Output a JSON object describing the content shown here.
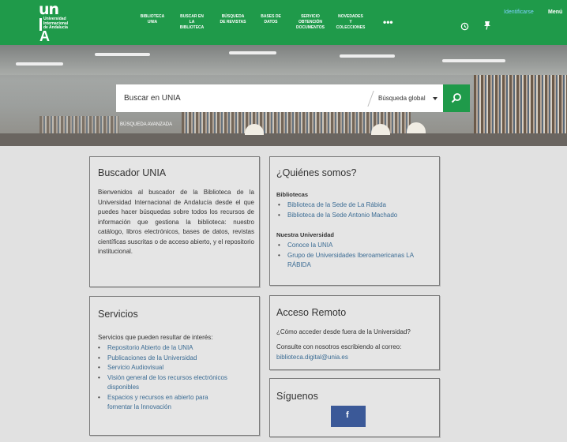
{
  "logo": {
    "un": "un",
    "lines": [
      "Universidad",
      "Internacional",
      "de Andalucía"
    ],
    "a": "A"
  },
  "nav": [
    "BIBLIOTECA\nUNIA",
    "BUSCAR EN\nLA\nBIBLIOTECA",
    "BÚSQUEDA\nDE REVISTAS",
    "BASES DE\nDATOS",
    "SERVICIO\nOBTENCIÓN\nDOCUMENTOS",
    "NOVEDADES\nY\nCOLECCIONES"
  ],
  "nav_more": "•••",
  "header": {
    "identify": "Identificarse",
    "menu": "Menú",
    "history_icon": "history-icon",
    "pin_icon": "pin-icon"
  },
  "search": {
    "placeholder": "Buscar en UNIA",
    "scope": "Búsqueda global",
    "advanced": "BÚSQUEDA AVANZADA",
    "button_icon": "search-icon"
  },
  "buscador": {
    "title": "Buscador UNIA",
    "text": "Bienvenidos al buscador de la Biblioteca de la Universidad Internacional de Andalucía desde el que puedes hacer búsquedas sobre todos los recursos de información que gestiona la biblioteca: nuestro catálogo, libros electrónicos, bases de datos, revistas científicas suscritas o de acceso abierto, y el repositorio institucional."
  },
  "quienes": {
    "title": "¿Quiénes somos?",
    "bibliotecas_label": "Bibliotecas",
    "bibliotecas": [
      "Biblioteca de la Sede de La Rábida",
      "Biblioteca de la Sede Antonio Machado"
    ],
    "universidad_label": "Nuestra Universidad",
    "universidad": [
      "Conoce la UNIA",
      "Grupo de Universidades Iberoamericanas LA RÁBIDA"
    ]
  },
  "servicios": {
    "title": "Servicios",
    "intro": "Servicios que pueden resultar de interés:",
    "items": [
      "Repositorio Abierto de la UNIA",
      "Publicaciones de la Universidad",
      "Servicio Audiovisual",
      "Visión general de los recursos electrónicos disponibles",
      "Espacios y recursos en abierto para fomentar la Innovación"
    ]
  },
  "acceso": {
    "title": "Acceso Remoto",
    "question": "¿Cómo acceder desde fuera de la Universidad?",
    "consult": "Consulte con nosotros escribiendo al correo:",
    "email": "biblioteca.digital@unia.es"
  },
  "siguenos": {
    "title": "Síguenos",
    "fb": "f",
    "fb_icon": "facebook-icon"
  },
  "colors": {
    "brand_green": "#1f9a4a",
    "link_blue": "#3b6c94",
    "facebook": "#3b5998"
  }
}
